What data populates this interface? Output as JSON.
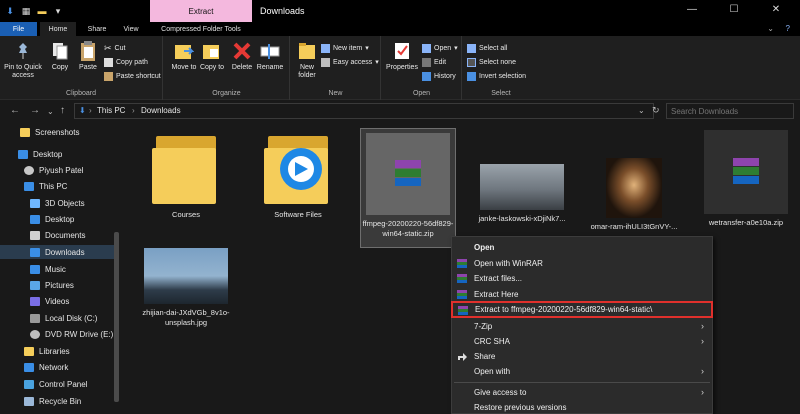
{
  "titlebar": {
    "context_tab": "Extract",
    "title": "Downloads",
    "controls": [
      "—",
      "☐",
      "✕"
    ]
  },
  "tabs": [
    {
      "label": "File"
    },
    {
      "label": "Home"
    },
    {
      "label": "Share"
    },
    {
      "label": "View"
    },
    {
      "label": "Compressed Folder Tools"
    }
  ],
  "ribbon": {
    "clipboard": {
      "pin_label": "Pin to Quick access",
      "copy_label": "Copy",
      "paste_label": "Paste",
      "cut_label": "Cut",
      "copy_path_label": "Copy path",
      "paste_shortcut_label": "Paste shortcut",
      "group_label": "Clipboard"
    },
    "organize": {
      "move_to_label": "Move to",
      "copy_to_label": "Copy to",
      "delete_label": "Delete",
      "rename_label": "Rename",
      "group_label": "Organize"
    },
    "new": {
      "new_folder_label": "New folder",
      "new_item_label": "New item",
      "easy_access_label": "Easy access",
      "group_label": "New"
    },
    "open": {
      "properties_label": "Properties",
      "open_label": "Open",
      "edit_label": "Edit",
      "history_label": "History",
      "group_label": "Open"
    },
    "select": {
      "select_all_label": "Select all",
      "select_none_label": "Select none",
      "invert_label": "Invert selection",
      "group_label": "Select"
    }
  },
  "address": {
    "crumbs": [
      "This PC",
      "Downloads"
    ],
    "search_placeholder": "Search Downloads"
  },
  "sidebar": {
    "items": [
      {
        "label": "Screenshots"
      },
      {
        "label": "Desktop"
      },
      {
        "label": "Piyush Patel"
      },
      {
        "label": "This PC"
      },
      {
        "label": "3D Objects"
      },
      {
        "label": "Desktop"
      },
      {
        "label": "Documents"
      },
      {
        "label": "Downloads"
      },
      {
        "label": "Music"
      },
      {
        "label": "Pictures"
      },
      {
        "label": "Videos"
      },
      {
        "label": "Local Disk (C:)"
      },
      {
        "label": "DVD RW Drive (E:)"
      },
      {
        "label": "Libraries"
      },
      {
        "label": "Network"
      },
      {
        "label": "Control Panel"
      },
      {
        "label": "Recycle Bin"
      }
    ]
  },
  "files": [
    {
      "name": "Courses"
    },
    {
      "name": "Software Files"
    },
    {
      "name": "ffmpeg-20200220-56df829-win64-static.zip"
    },
    {
      "name": "janke-laskowski-xDjiNk7..."
    },
    {
      "name": "omar-ram-ihULI3tGnVY-..."
    },
    {
      "name": "wetransfer-a0e10a.zip"
    },
    {
      "name": "zhijian-dai-JXdVGb_8v1o-unsplash.jpg"
    }
  ],
  "context_menu": {
    "items": [
      {
        "label": "Open"
      },
      {
        "label": "Open with WinRAR"
      },
      {
        "label": "Extract files..."
      },
      {
        "label": "Extract Here"
      },
      {
        "label": "Extract to ffmpeg-20200220-56df829-win64-static\\"
      },
      {
        "label": "7-Zip"
      },
      {
        "label": "CRC SHA"
      },
      {
        "label": "Share"
      },
      {
        "label": "Open with"
      },
      {
        "label": "Give access to"
      },
      {
        "label": "Restore previous versions"
      }
    ]
  },
  "colors": {
    "accent": "#1a5fb4",
    "context_tab": "#f4b8de",
    "highlight_box": "#e0302c",
    "folder": "#f5cd5a"
  }
}
